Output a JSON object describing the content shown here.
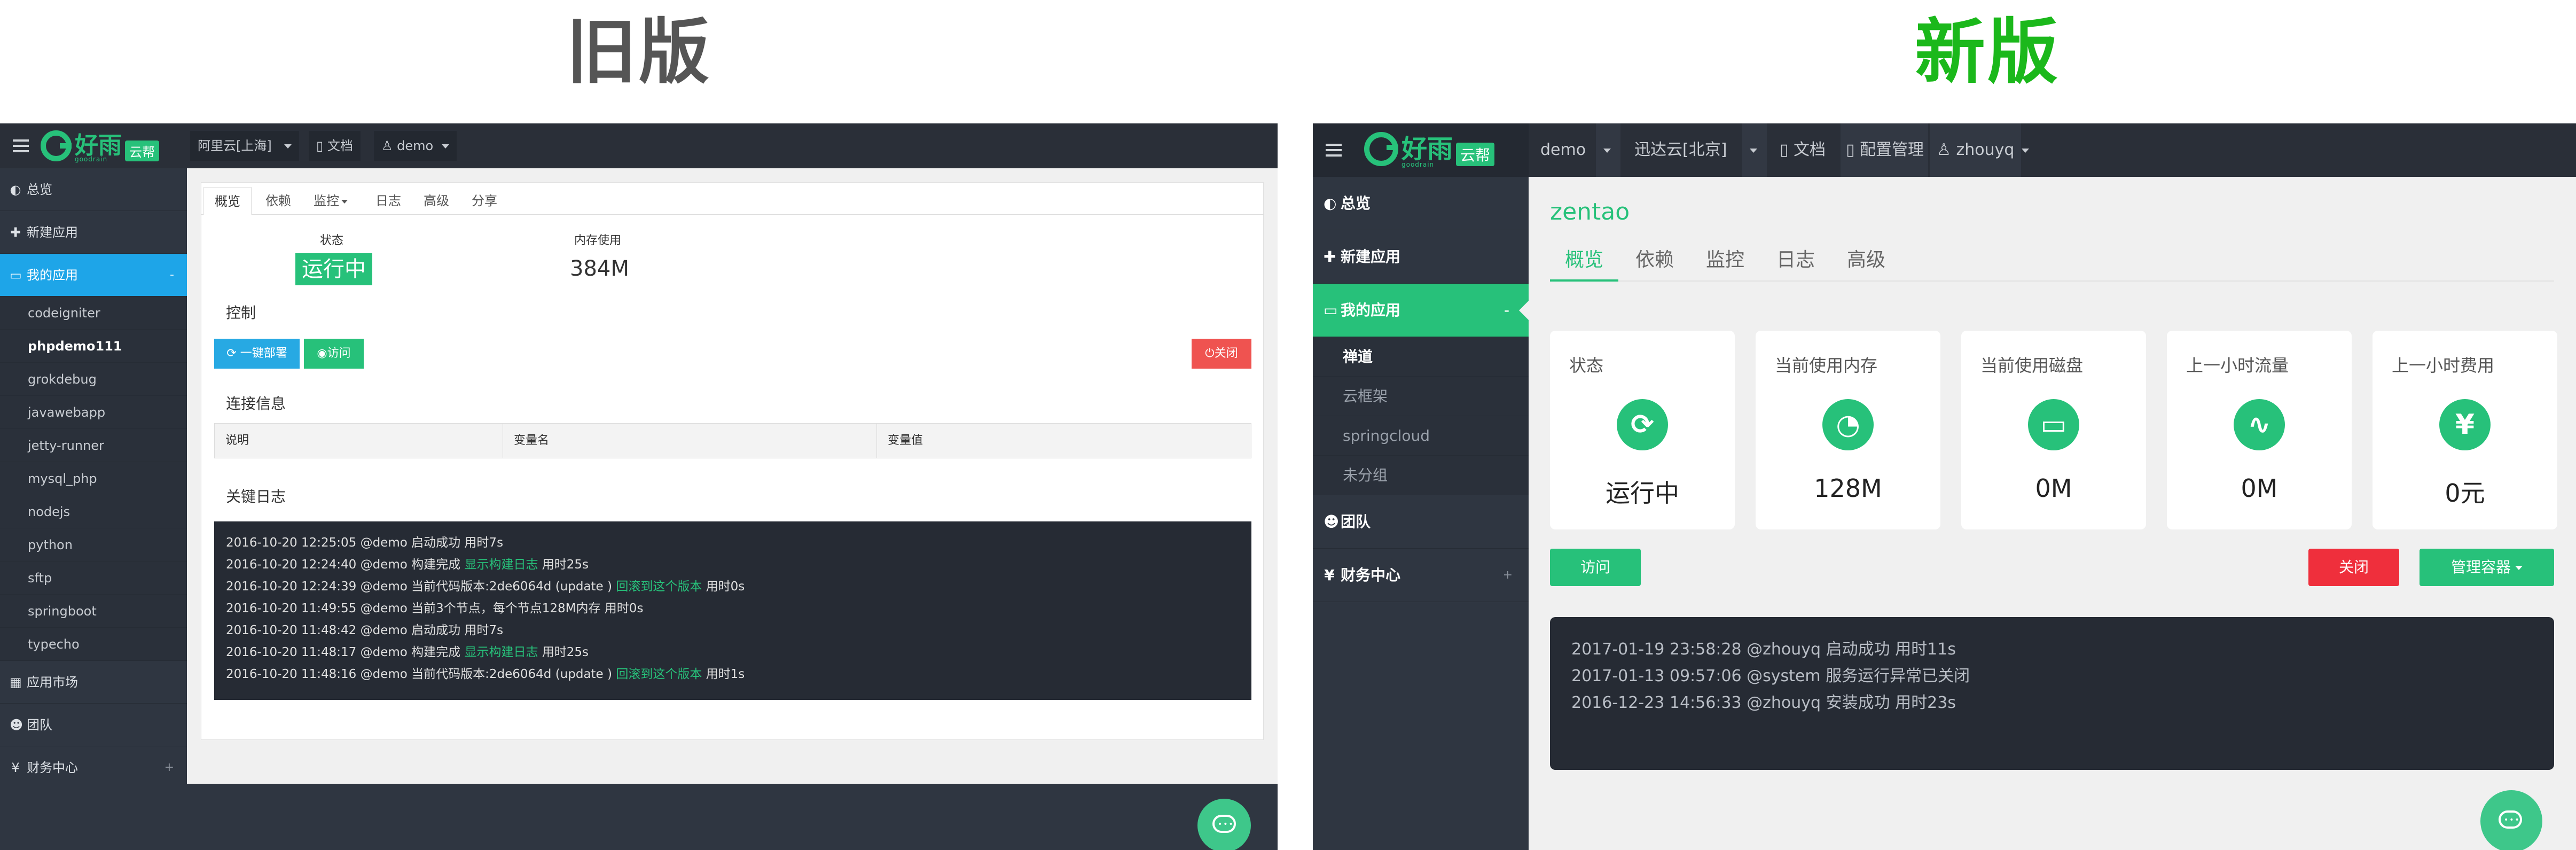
{
  "titles": {
    "old": "旧版",
    "new": "新版"
  },
  "old": {
    "logo": {
      "text": "好雨",
      "sub": "goodrain",
      "badge": "云帮"
    },
    "nav": [
      {
        "label": "阿里云[上海]"
      },
      {
        "label": "文档"
      },
      {
        "label": "demo"
      }
    ],
    "sidebar": {
      "items": [
        {
          "label": "总览"
        },
        {
          "label": "新建应用"
        },
        {
          "label": "我的应用"
        }
      ],
      "apps": [
        "codeigniter",
        "phpdemo111",
        "grokdebug",
        "javawebapp",
        "jetty-runner",
        "mysql_php",
        "nodejs",
        "python",
        "sftp",
        "springboot",
        "typecho"
      ],
      "bottom": [
        {
          "label": "应用市场"
        },
        {
          "label": "团队"
        },
        {
          "label": "财务中心"
        }
      ],
      "plus": "+",
      "minus": "-"
    },
    "tabs": [
      "概览",
      "依赖",
      "监控",
      "日志",
      "高级",
      "分享"
    ],
    "status_label": "状态",
    "status_value": "运行中",
    "memory_label": "内存使用",
    "memory_value": "384M",
    "control_label": "控制",
    "buttons": {
      "deploy": "一键部署",
      "visit": "访问",
      "close": "关闭"
    },
    "conn_label": "连接信息",
    "conn_columns": [
      "说明",
      "变量名",
      "变量值"
    ],
    "log_label": "关键日志",
    "logs": [
      {
        "pre": "2016-10-20 12:25:05 @demo 启动成功 用时7s",
        "hl": "",
        "post": ""
      },
      {
        "pre": "2016-10-20 12:24:40 @demo 构建完成 ",
        "hl": "显示构建日志",
        "post": " 用时25s"
      },
      {
        "pre": "2016-10-20 12:24:39 @demo 当前代码版本:2de6064d (update ) ",
        "hl": "回滚到这个版本",
        "post": " 用时0s"
      },
      {
        "pre": "2016-10-20 11:49:55 @demo 当前3个节点，每个节点128M内存 用时0s",
        "hl": "",
        "post": ""
      },
      {
        "pre": "2016-10-20 11:48:42 @demo 启动成功 用时7s",
        "hl": "",
        "post": ""
      },
      {
        "pre": "2016-10-20 11:48:17 @demo 构建完成 ",
        "hl": "显示构建日志",
        "post": " 用时25s"
      },
      {
        "pre": "2016-10-20 11:48:16 @demo 当前代码版本:2de6064d (update ) ",
        "hl": "回滚到这个版本",
        "post": " 用时1s"
      }
    ]
  },
  "new": {
    "logo": {
      "text": "好雨",
      "sub": "goodrain",
      "badge": "云帮"
    },
    "nav": [
      {
        "label": "demo"
      },
      {
        "label": "迅达云[北京]"
      },
      {
        "label": "文档"
      },
      {
        "label": "配置管理"
      },
      {
        "label": "zhouyq"
      }
    ],
    "sidebar": {
      "items": [
        {
          "label": "总览"
        },
        {
          "label": "新建应用"
        },
        {
          "label": "我的应用"
        }
      ],
      "groups": [
        "禅道",
        "云框架",
        "springcloud",
        "未分组"
      ],
      "bottom": [
        {
          "label": "团队"
        },
        {
          "label": "财务中心"
        }
      ],
      "plus": "+",
      "minus": "-"
    },
    "app_name": "zentao",
    "tabs": [
      "概览",
      "依赖",
      "监控",
      "日志",
      "高级"
    ],
    "cards": [
      {
        "label": "状态",
        "value": "运行中",
        "icon": "refresh-icon"
      },
      {
        "label": "当前使用内存",
        "value": "128M",
        "icon": "speedometer-icon"
      },
      {
        "label": "当前使用磁盘",
        "value": "0M",
        "icon": "hard-drive-icon"
      },
      {
        "label": "上一小时流量",
        "value": "0M",
        "icon": "pulse-icon"
      },
      {
        "label": "上一小时费用",
        "value": "0元",
        "icon": "money-bag-icon"
      }
    ],
    "buttons": {
      "visit": "访问",
      "close": "关闭",
      "manage": "管理容器"
    },
    "logs": [
      "2017-01-19 23:58:28 @zhouyq 启动成功 用时11s",
      "2017-01-13 09:57:06 @system 服务运行异常已关闭",
      "2016-12-23 14:56:33 @zhouyq 安装成功 用时23s"
    ]
  },
  "colors": {
    "accent": "#27c17a",
    "blue": "#1ea5e8",
    "red": "#ef5350",
    "dark": "#2a2f38"
  }
}
